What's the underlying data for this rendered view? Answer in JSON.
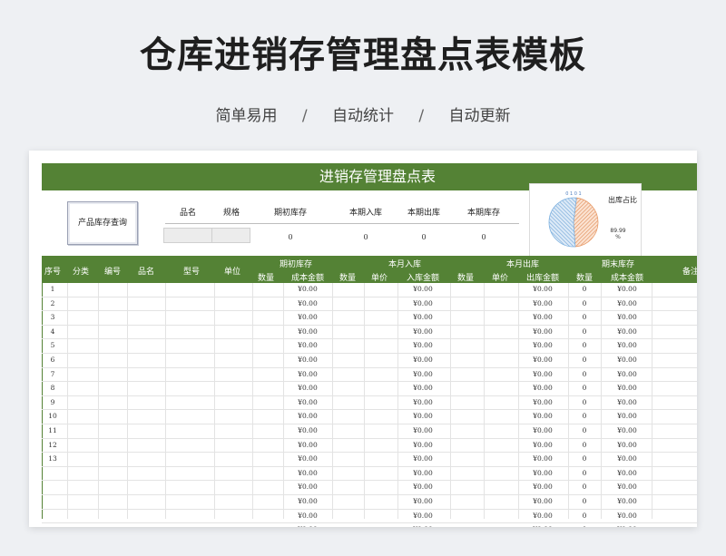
{
  "header": {
    "title": "仓库进销存管理盘点表模板",
    "features": [
      "简单易用",
      "自动统计",
      "自动更新"
    ],
    "separator": "/"
  },
  "sheet": {
    "title": "进销存管理盘点表",
    "accent_color": "#548235"
  },
  "query": {
    "box_label": "产品库存查询",
    "headers": [
      "品名",
      "规格",
      "期初库存",
      "本期入库",
      "本期出库",
      "本期库存"
    ],
    "values": [
      "0",
      "0",
      "0",
      "0"
    ]
  },
  "pie": {
    "title": "出库占比",
    "top_label": "0 1 0 1",
    "value_label": "89.99",
    "unit_label": "%",
    "slices": [
      {
        "share": 0.47,
        "color": "#e89c6a"
      },
      {
        "share": 0.53,
        "color": "#7fb2e0"
      }
    ]
  },
  "table": {
    "top_headers": {
      "seq": "序号",
      "category": "分类",
      "code": "编号",
      "name": "品名",
      "model": "型号",
      "unit": "单位",
      "opening": "期初库存",
      "inbound": "本月入库",
      "outbound": "本月出库",
      "closing": "期末库存",
      "note": "备注"
    },
    "sub_headers": {
      "opening_qty": "数量",
      "opening_cost": "成本金额",
      "in_qty": "数量",
      "in_price": "单价",
      "in_amount": "入库金额",
      "out_qty": "数量",
      "out_price": "单价",
      "out_amount": "出库金额",
      "close_qty": "数量",
      "close_cost": "成本金额"
    },
    "money": "¥0.00",
    "zero": "0",
    "row_numbers": [
      "1",
      "2",
      "3",
      "4",
      "5",
      "6",
      "7",
      "8",
      "9",
      "10",
      "11",
      "12",
      "13",
      "",
      "",
      "",
      "",
      ""
    ]
  }
}
